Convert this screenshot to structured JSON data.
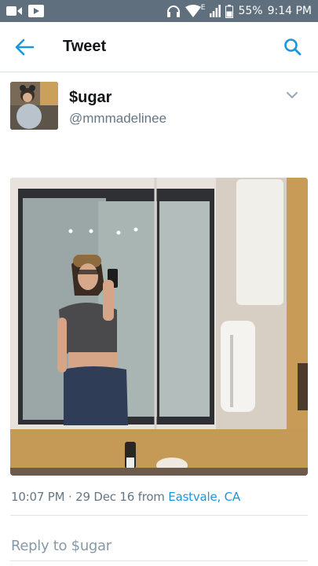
{
  "status_bar": {
    "battery": "55%",
    "time": "9:14 PM",
    "network": "E",
    "icons": [
      "video-icon",
      "message-icon",
      "headphones-icon",
      "wifi-icon",
      "signal-icon",
      "battery-icon"
    ]
  },
  "header": {
    "title": "Tweet",
    "back_icon": "back-arrow-icon",
    "search_icon": "search-icon"
  },
  "tweet": {
    "author_name": "$ugar",
    "author_handle": "@mmmadelinee",
    "time": "10:07 PM",
    "separator": " · ",
    "date": "29 Dec 16",
    "from_text": " from ",
    "place": "Eastvale, CA",
    "menu_icon": "chevron-down-icon"
  },
  "reply": {
    "placeholder": "Reply to $ugar"
  },
  "colors": {
    "accent": "#1b95e0",
    "status_bar": "#5f6f7e",
    "muted_text": "#657786"
  }
}
